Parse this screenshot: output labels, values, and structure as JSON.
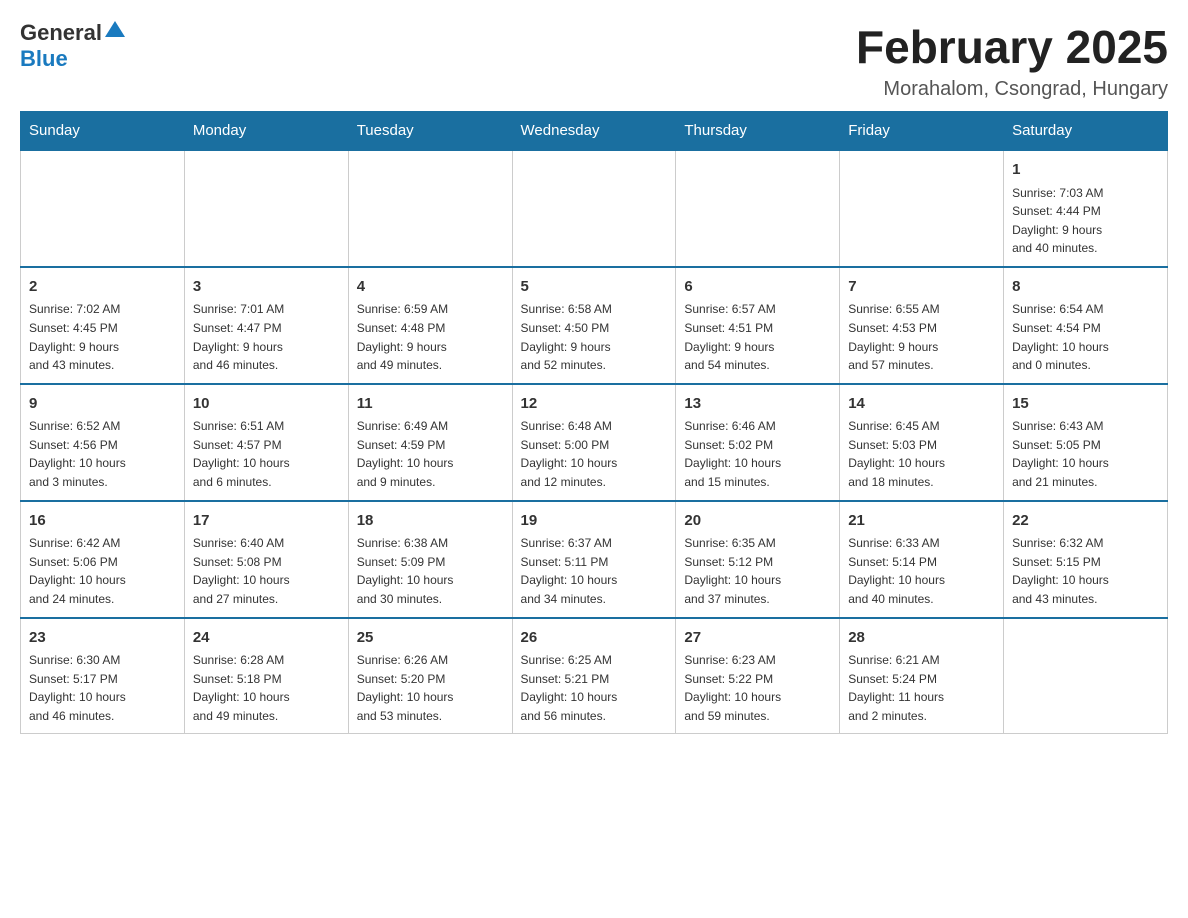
{
  "header": {
    "logo_general": "General",
    "logo_blue": "Blue",
    "month_title": "February 2025",
    "location": "Morahalom, Csongrad, Hungary"
  },
  "weekdays": [
    "Sunday",
    "Monday",
    "Tuesday",
    "Wednesday",
    "Thursday",
    "Friday",
    "Saturday"
  ],
  "weeks": [
    [
      {
        "day": "",
        "info": ""
      },
      {
        "day": "",
        "info": ""
      },
      {
        "day": "",
        "info": ""
      },
      {
        "day": "",
        "info": ""
      },
      {
        "day": "",
        "info": ""
      },
      {
        "day": "",
        "info": ""
      },
      {
        "day": "1",
        "info": "Sunrise: 7:03 AM\nSunset: 4:44 PM\nDaylight: 9 hours\nand 40 minutes."
      }
    ],
    [
      {
        "day": "2",
        "info": "Sunrise: 7:02 AM\nSunset: 4:45 PM\nDaylight: 9 hours\nand 43 minutes."
      },
      {
        "day": "3",
        "info": "Sunrise: 7:01 AM\nSunset: 4:47 PM\nDaylight: 9 hours\nand 46 minutes."
      },
      {
        "day": "4",
        "info": "Sunrise: 6:59 AM\nSunset: 4:48 PM\nDaylight: 9 hours\nand 49 minutes."
      },
      {
        "day": "5",
        "info": "Sunrise: 6:58 AM\nSunset: 4:50 PM\nDaylight: 9 hours\nand 52 minutes."
      },
      {
        "day": "6",
        "info": "Sunrise: 6:57 AM\nSunset: 4:51 PM\nDaylight: 9 hours\nand 54 minutes."
      },
      {
        "day": "7",
        "info": "Sunrise: 6:55 AM\nSunset: 4:53 PM\nDaylight: 9 hours\nand 57 minutes."
      },
      {
        "day": "8",
        "info": "Sunrise: 6:54 AM\nSunset: 4:54 PM\nDaylight: 10 hours\nand 0 minutes."
      }
    ],
    [
      {
        "day": "9",
        "info": "Sunrise: 6:52 AM\nSunset: 4:56 PM\nDaylight: 10 hours\nand 3 minutes."
      },
      {
        "day": "10",
        "info": "Sunrise: 6:51 AM\nSunset: 4:57 PM\nDaylight: 10 hours\nand 6 minutes."
      },
      {
        "day": "11",
        "info": "Sunrise: 6:49 AM\nSunset: 4:59 PM\nDaylight: 10 hours\nand 9 minutes."
      },
      {
        "day": "12",
        "info": "Sunrise: 6:48 AM\nSunset: 5:00 PM\nDaylight: 10 hours\nand 12 minutes."
      },
      {
        "day": "13",
        "info": "Sunrise: 6:46 AM\nSunset: 5:02 PM\nDaylight: 10 hours\nand 15 minutes."
      },
      {
        "day": "14",
        "info": "Sunrise: 6:45 AM\nSunset: 5:03 PM\nDaylight: 10 hours\nand 18 minutes."
      },
      {
        "day": "15",
        "info": "Sunrise: 6:43 AM\nSunset: 5:05 PM\nDaylight: 10 hours\nand 21 minutes."
      }
    ],
    [
      {
        "day": "16",
        "info": "Sunrise: 6:42 AM\nSunset: 5:06 PM\nDaylight: 10 hours\nand 24 minutes."
      },
      {
        "day": "17",
        "info": "Sunrise: 6:40 AM\nSunset: 5:08 PM\nDaylight: 10 hours\nand 27 minutes."
      },
      {
        "day": "18",
        "info": "Sunrise: 6:38 AM\nSunset: 5:09 PM\nDaylight: 10 hours\nand 30 minutes."
      },
      {
        "day": "19",
        "info": "Sunrise: 6:37 AM\nSunset: 5:11 PM\nDaylight: 10 hours\nand 34 minutes."
      },
      {
        "day": "20",
        "info": "Sunrise: 6:35 AM\nSunset: 5:12 PM\nDaylight: 10 hours\nand 37 minutes."
      },
      {
        "day": "21",
        "info": "Sunrise: 6:33 AM\nSunset: 5:14 PM\nDaylight: 10 hours\nand 40 minutes."
      },
      {
        "day": "22",
        "info": "Sunrise: 6:32 AM\nSunset: 5:15 PM\nDaylight: 10 hours\nand 43 minutes."
      }
    ],
    [
      {
        "day": "23",
        "info": "Sunrise: 6:30 AM\nSunset: 5:17 PM\nDaylight: 10 hours\nand 46 minutes."
      },
      {
        "day": "24",
        "info": "Sunrise: 6:28 AM\nSunset: 5:18 PM\nDaylight: 10 hours\nand 49 minutes."
      },
      {
        "day": "25",
        "info": "Sunrise: 6:26 AM\nSunset: 5:20 PM\nDaylight: 10 hours\nand 53 minutes."
      },
      {
        "day": "26",
        "info": "Sunrise: 6:25 AM\nSunset: 5:21 PM\nDaylight: 10 hours\nand 56 minutes."
      },
      {
        "day": "27",
        "info": "Sunrise: 6:23 AM\nSunset: 5:22 PM\nDaylight: 10 hours\nand 59 minutes."
      },
      {
        "day": "28",
        "info": "Sunrise: 6:21 AM\nSunset: 5:24 PM\nDaylight: 11 hours\nand 2 minutes."
      },
      {
        "day": "",
        "info": ""
      }
    ]
  ]
}
